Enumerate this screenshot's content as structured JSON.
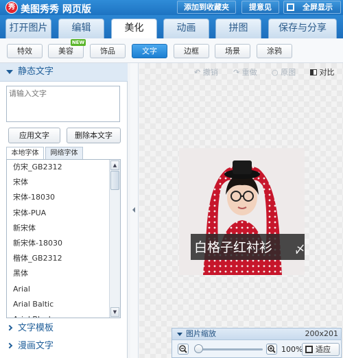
{
  "app": {
    "logo_text": "秀",
    "title": "美图秀秀 网页版"
  },
  "top_buttons": {
    "favorite": "添加到收藏夹",
    "feedback": "提意见",
    "fullscreen": "全屏显示"
  },
  "main_tabs": [
    "打开图片",
    "编辑",
    "美化",
    "动画",
    "拼图",
    "保存与分享"
  ],
  "active_main_tab": "美化",
  "sub_tabs": [
    "特效",
    "美容",
    "饰品",
    "文字",
    "边框",
    "场景",
    "涂鸦"
  ],
  "active_sub_tab": "文字",
  "new_badge": "NEW",
  "left_panel": {
    "section_title": "静态文字",
    "text_input_placeholder": "请输入文字",
    "apply_button": "应用文字",
    "delete_button": "删除本文字",
    "font_tabs": [
      "本地字体",
      "网络字体"
    ],
    "fonts": [
      "仿宋_GB2312",
      "宋体",
      "宋体-18030",
      "宋体-PUA",
      "新宋体",
      "新宋体-18030",
      "楷体_GB2312",
      "黑体",
      "Arial",
      "Arial Baltic",
      "Arial Black"
    ],
    "collapsed_sections": [
      "文字模板",
      "漫画文字"
    ]
  },
  "toolbar": {
    "undo": "撤销",
    "redo": "重做",
    "original": "原图",
    "compare": "对比"
  },
  "photo_caption": "白格子红衬衫",
  "zoom_panel": {
    "title": "图片缩放",
    "size": "200x201",
    "zoom": "100%",
    "fit": "适应"
  }
}
